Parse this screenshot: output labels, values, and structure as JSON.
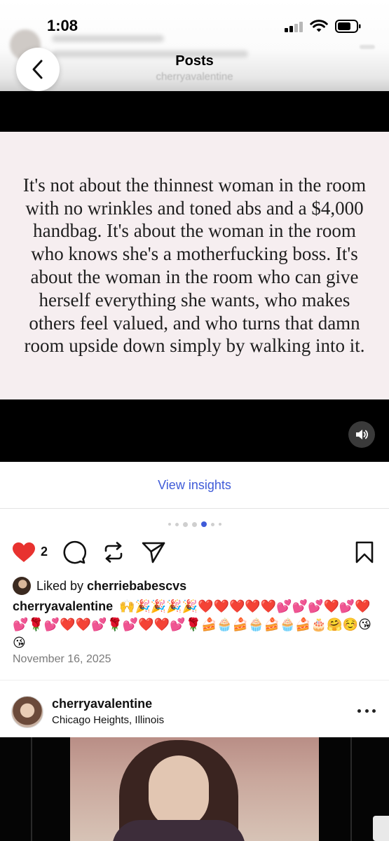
{
  "status_bar": {
    "time": "1:08"
  },
  "header": {
    "title": "Posts",
    "subtitle": "cherryavalentine",
    "blurred_line_1": "cherryavalentine",
    "blurred_line_2": "Imagine Dragons · Bones & Takes"
  },
  "post": {
    "quote": "It's not about the thinnest woman in the room with no wrinkles and toned abs and a $4,000 handbag. It's about the woman in the room who knows she's a motherfucking boss. It's about the woman in the room who can give herself everything she wants, who makes others feel valued, and who turns that damn room upside down simply by walking into it.",
    "insights_label": "View insights",
    "carousel": {
      "total": 7,
      "active": 4
    },
    "like_count": "2",
    "liked_by_prefix": "Liked by",
    "liked_by_user": "cherriebabescvs",
    "caption_user": "cherryavalentine",
    "caption_text": "🙌🎉🎉🎉🎉❤️❤️❤️❤️❤️💕💕💕❤️💕❤️💕🌹💕❤️❤️💕🌹💕❤️❤️💕🌹🍰🧁🍰🧁🍰🧁🍰🎂🤗☺️😘😘",
    "date": "November 16, 2025"
  },
  "next_post": {
    "username": "cherryavalentine",
    "location": "Chicago Heights, Illinois"
  },
  "colors": {
    "accent_link": "#3f5bd8",
    "like_red": "#e8322f",
    "quote_bg": "#f6eef0",
    "media_bg": "#000000"
  },
  "icons": [
    "back-chevron-icon",
    "volume-icon",
    "heart-icon",
    "comment-icon",
    "repost-icon",
    "share-icon",
    "bookmark-icon",
    "more-icon"
  ]
}
